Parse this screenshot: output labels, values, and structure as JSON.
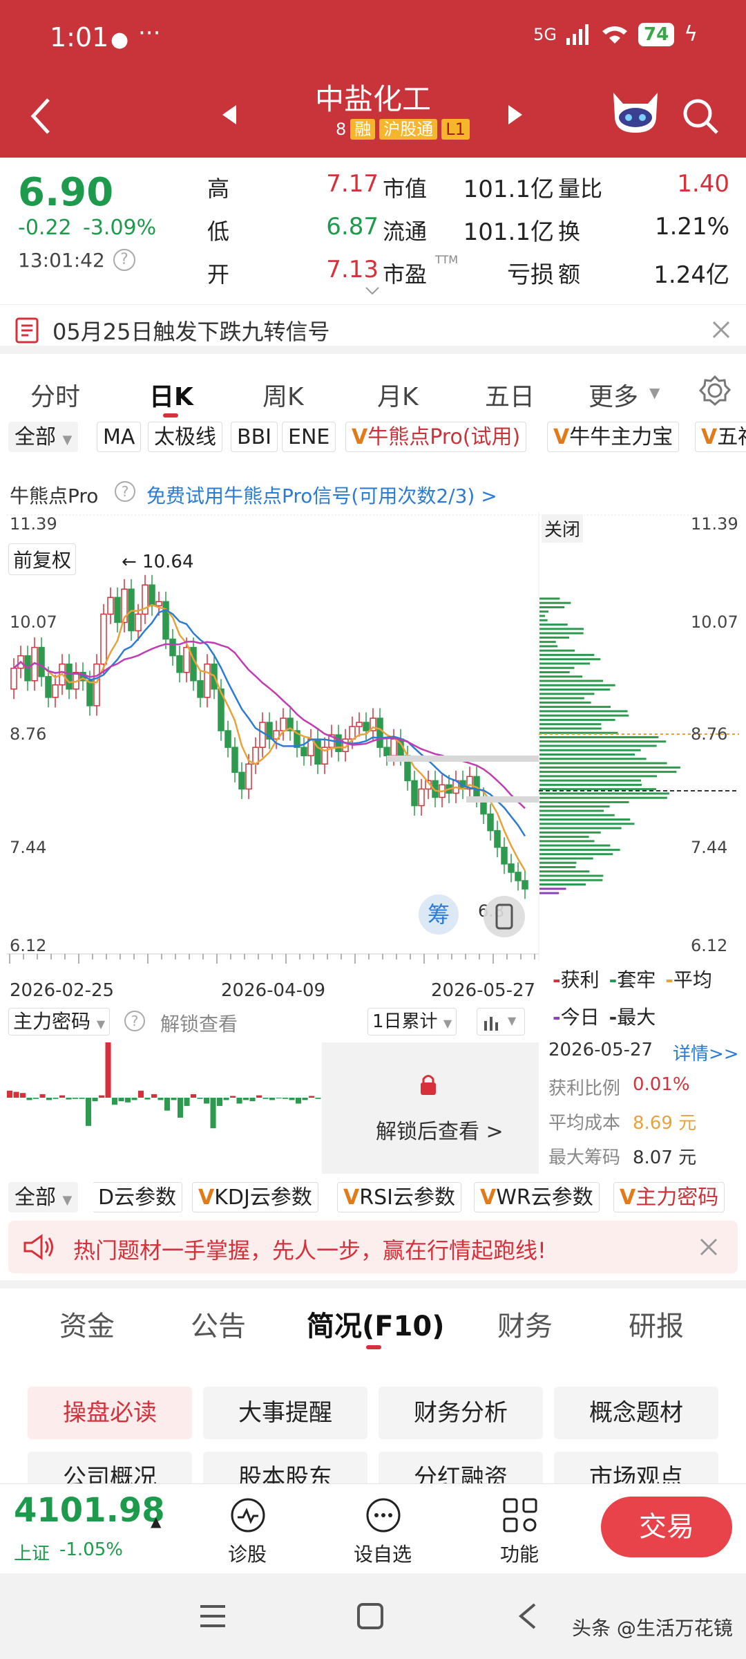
{
  "status": {
    "time": "1:01",
    "dots": "···",
    "network": "5G",
    "wifi_sub": "6",
    "battery": "74"
  },
  "header": {
    "title": "中盐化工",
    "badge_num": "8",
    "badge_rong": "融",
    "badge_hgt": "沪股通",
    "badge_l1": "L1"
  },
  "quote": {
    "price": "6.90",
    "change": "-0.22",
    "change_pct": "-3.09%",
    "time": "13:01:42",
    "rows": [
      {
        "l1": "高",
        "v1": "7.17",
        "l2": "市值",
        "v2": "101.1亿",
        "l3": "量比",
        "v3": "1.40"
      },
      {
        "l1": "低",
        "v1": "6.87",
        "l2": "流通",
        "v2": "101.1亿",
        "l3": "换",
        "v3": "1.21%"
      },
      {
        "l1": "开",
        "v1": "7.13",
        "l2": "市盈",
        "l2sup": "TTM",
        "v2": "亏损",
        "l3": "额",
        "v3": "1.24亿"
      }
    ]
  },
  "signal": {
    "text": "05月25日触发下跌九转信号"
  },
  "period_tabs": [
    "分时",
    "日K",
    "周K",
    "月K",
    "五日",
    "更多"
  ],
  "active_period": "日K",
  "indicators": {
    "all": "全部",
    "items": [
      "MA",
      "太极线",
      "BBI",
      "ENE"
    ],
    "v_items": [
      "牛熊点Pro(试用)",
      "牛牛主力宝",
      "五福"
    ]
  },
  "pro_bar": {
    "label": "牛熊点Pro",
    "link": "免费试用牛熊点Pro信号(可用次数2/3) >"
  },
  "chart": {
    "fq": "前复权",
    "max_label": "← 10.64",
    "close_btn": "关闭",
    "chou": "筹",
    "y_ticks": [
      "11.39",
      "10.07",
      "8.76",
      "7.44",
      "6.12"
    ],
    "dates": [
      "2026-02-25",
      "2026-04-09",
      "2026-05-27"
    ],
    "last_label": "6.8"
  },
  "chart_data": {
    "type": "candlestick",
    "y_range": [
      6.12,
      11.39
    ],
    "x_range": [
      "2026-02-25",
      "2026-05-27"
    ],
    "y_ticks": [
      11.39,
      10.07,
      8.76,
      7.44,
      6.12
    ],
    "max_price": 10.64,
    "last_close": 6.9
  },
  "chip_legend": {
    "items": [
      "获利",
      "套牢",
      "平均",
      "今日",
      "最大"
    ],
    "colors": [
      "#d6303a",
      "#1d9a4c",
      "#e8a23a",
      "#8a3fbf",
      "#333333"
    ]
  },
  "main_force": {
    "label": "主力密码",
    "unlock": "解锁查看",
    "period": "1日累计",
    "unlock_btn": "解锁后查看 >"
  },
  "chip_info": {
    "date": "2026-05-27",
    "detail": "详情>>",
    "profit_label": "获利比例",
    "profit": "0.01%",
    "avg_label": "平均成本",
    "avg": "8.69 元",
    "max_label": "最大筹码",
    "max": "8.07 元"
  },
  "cloud_params": {
    "all": "全部",
    "items": [
      "D云参数",
      "KDJ云参数",
      "RSI云参数",
      "WR云参数",
      "主力密码"
    ]
  },
  "ad": {
    "text": "热门题材一手掌握，先人一步，赢在行情起跑线!"
  },
  "bottom_tabs": [
    "资金",
    "公告",
    "简况(F10)",
    "财务",
    "研报"
  ],
  "active_bottom": "简况(F10)",
  "f10_buttons": [
    "操盘必读",
    "大事提醒",
    "财务分析",
    "概念题材",
    "公司概况",
    "股本股东",
    "分红融资",
    "市场观点"
  ],
  "footer": {
    "index": "4101.98",
    "index_name": "上证",
    "index_pct": "-1.05%",
    "nav": [
      "诊股",
      "设自选",
      "功能"
    ],
    "trade": "交易"
  },
  "watermark": "头条 @生活万花镜"
}
